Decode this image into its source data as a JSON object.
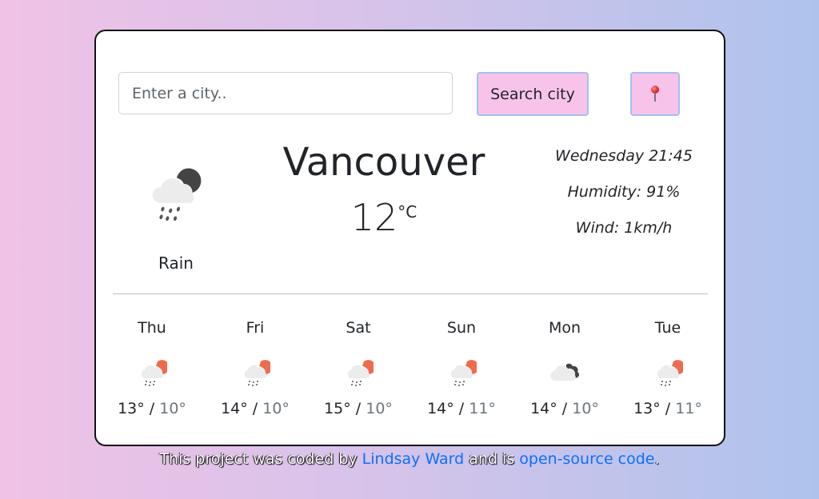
{
  "search": {
    "placeholder": "Enter a city..",
    "value": "",
    "button_label": "Search city",
    "location_button_icon": "round-pushpin-icon"
  },
  "current": {
    "city": "Vancouver",
    "temperature": "12",
    "unit": "°C",
    "condition": "Rain",
    "icon": "rain-night-icon",
    "datetime": "Wednesday 21:45",
    "humidity": "Humidity: 91%",
    "wind": "Wind: 1km/h"
  },
  "forecast": [
    {
      "day": "Thu",
      "max": "13°",
      "min": "10°",
      "icon": "rain-sun-icon"
    },
    {
      "day": "Fri",
      "max": "14°",
      "min": "10°",
      "icon": "rain-sun-icon"
    },
    {
      "day": "Sat",
      "max": "15°",
      "min": "10°",
      "icon": "rain-sun-icon"
    },
    {
      "day": "Sun",
      "max": "14°",
      "min": "11°",
      "icon": "rain-sun-icon"
    },
    {
      "day": "Mon",
      "max": "14°",
      "min": "10°",
      "icon": "broken-clouds-icon"
    },
    {
      "day": "Tue",
      "max": "13°",
      "min": "11°",
      "icon": "rain-sun-icon"
    }
  ],
  "separator": "/",
  "footer": {
    "text_before": "This project was coded by ",
    "author_link": "Lindsay Ward",
    "text_middle": " and is ",
    "source_link": "open-source code",
    "text_after": "."
  },
  "colors": {
    "button_bg": "#f8c3eb",
    "button_border": "#a3c1ee",
    "link": "#0d6efd",
    "sun": "#ee6b4d",
    "moon": "#444444"
  }
}
